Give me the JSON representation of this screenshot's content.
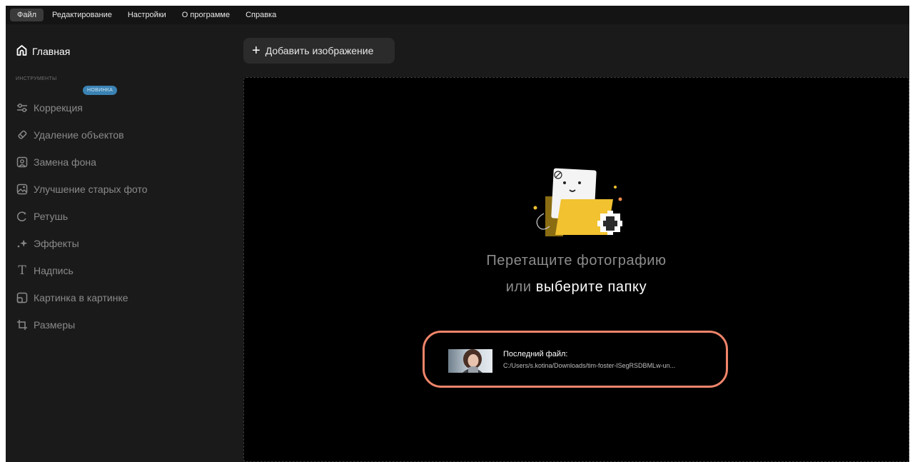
{
  "menu": {
    "items": [
      "Файл",
      "Редактирование",
      "Настройки",
      "О программе",
      "Справка"
    ]
  },
  "sidebar": {
    "home_label": "Главная",
    "section_label": "ИНСТРУМЕНТЫ",
    "badge": "НОВИНКА",
    "tools": [
      {
        "label": "Коррекция",
        "icon": "sliders-icon"
      },
      {
        "label": "Удаление объектов",
        "icon": "eraser-icon"
      },
      {
        "label": "Замена фона",
        "icon": "portrait-icon"
      },
      {
        "label": "Улучшение старых фото",
        "icon": "photo-enhance-icon"
      },
      {
        "label": "Ретушь",
        "icon": "retouch-icon"
      },
      {
        "label": "Эффекты",
        "icon": "sparkle-icon"
      },
      {
        "label": "Надпись",
        "icon": "text-icon"
      },
      {
        "label": "Картинка в картинке",
        "icon": "picture-in-picture-icon"
      },
      {
        "label": "Размеры",
        "icon": "crop-icon"
      }
    ]
  },
  "toolbar": {
    "add_image_label": "Добавить изображение"
  },
  "dropzone": {
    "line1": "Перетащите фотографию",
    "line2_prefix": "или",
    "line2_link": "выберите папку"
  },
  "recent_file": {
    "title": "Последний файл:",
    "path": "C:/Users/s.kotina/Downloads/tim-foster-lSegRSDBMLw-un..."
  },
  "colors": {
    "background": "#1a1a1a",
    "dropzone": "#000000",
    "highlight": "#f0856a",
    "badge": "#3a82b3",
    "folder": "#f2c230"
  }
}
